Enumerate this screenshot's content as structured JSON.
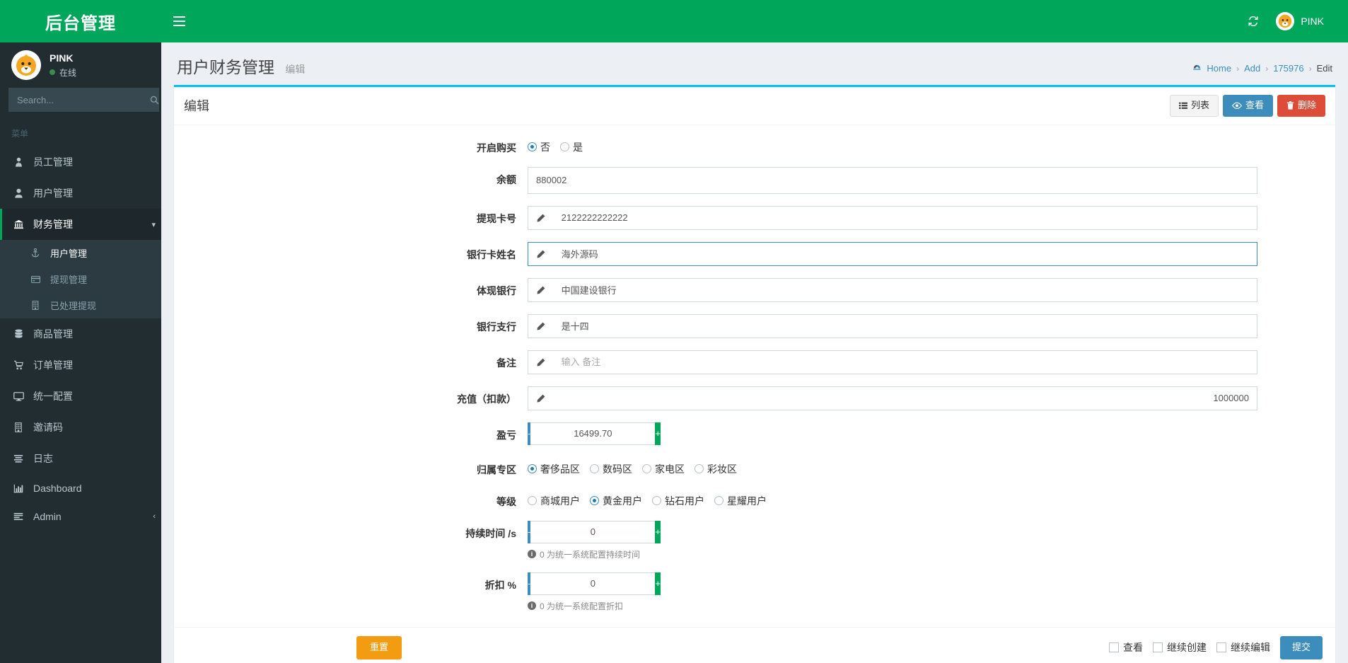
{
  "brand": {
    "logo_text": "后台管理"
  },
  "topbar": {
    "menu_toggle_icon": "hamburger-icon",
    "refresh_icon": "refresh-icon",
    "user_name": "PINK"
  },
  "sidebar": {
    "user": {
      "name": "PINK",
      "status": "在线"
    },
    "search": {
      "placeholder": "Search...",
      "value": "",
      "icon": "search-icon"
    },
    "menu_header": "菜单",
    "items": [
      {
        "label": "员工管理",
        "icon": "user-tie-icon",
        "active": false
      },
      {
        "label": "用户管理",
        "icon": "user-icon",
        "active": false
      },
      {
        "label": "财务管理",
        "icon": "bank-icon",
        "active": true,
        "chevron": "▾",
        "children": [
          {
            "label": "用户管理",
            "icon": "anchor-icon",
            "active": true
          },
          {
            "label": "提现管理",
            "icon": "credit-card-icon",
            "active": false
          },
          {
            "label": "已处理提现",
            "icon": "building-icon",
            "active": false
          }
        ]
      },
      {
        "label": "商品管理",
        "icon": "database-icon",
        "active": false
      },
      {
        "label": "订单管理",
        "icon": "cart-icon",
        "active": false
      },
      {
        "label": "统一配置",
        "icon": "desktop-icon",
        "active": false
      },
      {
        "label": "邀请码",
        "icon": "building-icon",
        "active": false
      },
      {
        "label": "日志",
        "icon": "list-icon",
        "active": false
      },
      {
        "label": "Dashboard",
        "icon": "chart-bar-icon",
        "active": false
      },
      {
        "label": "Admin",
        "icon": "list-alt-icon",
        "active": false,
        "chevron": "‹"
      }
    ]
  },
  "header": {
    "title": "用户财务管理",
    "subtitle": "编辑",
    "breadcrumb": [
      {
        "label": "Home",
        "icon": "dashboard-icon"
      },
      {
        "label": "Add"
      },
      {
        "label": "175976"
      },
      {
        "label": "Edit"
      }
    ],
    "separator": "›"
  },
  "box": {
    "title": "编辑",
    "tools": [
      {
        "label": "列表",
        "icon": "list-icon",
        "style": "default"
      },
      {
        "label": "查看",
        "icon": "eye-icon",
        "style": "info"
      },
      {
        "label": "删除",
        "icon": "trash-icon",
        "style": "danger"
      }
    ]
  },
  "form": {
    "purchase": {
      "label": "开启购买",
      "options": [
        {
          "label": "否",
          "selected": true
        },
        {
          "label": "是",
          "selected": false
        }
      ]
    },
    "balance": {
      "label": "余额",
      "value": "880002",
      "placeholder": ""
    },
    "card_no": {
      "label": "提现卡号",
      "value": "2122222222222",
      "placeholder": "",
      "icon": "pencil-icon"
    },
    "card_name": {
      "label": "银行卡姓名",
      "value": "海外源码",
      "placeholder": "",
      "icon": "pencil-icon",
      "focused": true
    },
    "bank": {
      "label": "体现银行",
      "value": "中国建设银行",
      "placeholder": "",
      "icon": "pencil-icon"
    },
    "branch": {
      "label": "银行支行",
      "value": "是十四",
      "placeholder": "",
      "icon": "pencil-icon"
    },
    "remark": {
      "label": "备注",
      "value": "",
      "placeholder": "输入 备注",
      "icon": "pencil-icon"
    },
    "recharge": {
      "label": "充值（扣款）",
      "value": "1000000",
      "placeholder": "",
      "icon": "pencil-icon"
    },
    "profit": {
      "label": "盈亏",
      "value": "16499.70",
      "minus": "-",
      "plus": "+"
    },
    "zone": {
      "label": "归属专区",
      "options": [
        {
          "label": "奢侈品区",
          "selected": true
        },
        {
          "label": "数码区",
          "selected": false
        },
        {
          "label": "家电区",
          "selected": false
        },
        {
          "label": "彩妆区",
          "selected": false
        }
      ]
    },
    "level": {
      "label": "等级",
      "options": [
        {
          "label": "商城用户",
          "selected": false
        },
        {
          "label": "黄金用户",
          "selected": true
        },
        {
          "label": "钻石用户",
          "selected": false
        },
        {
          "label": "星耀用户",
          "selected": false
        }
      ]
    },
    "duration": {
      "label": "持续时间 /s",
      "value": "0",
      "minus": "-",
      "plus": "+",
      "hint": "0 为统一系统配置持续时间"
    },
    "discount": {
      "label": "折扣 %",
      "value": "0",
      "minus": "-",
      "plus": "+",
      "hint": "0 为统一系统配置折扣"
    }
  },
  "footer": {
    "reset_label": "重置",
    "checkboxes": [
      {
        "label": "查看",
        "checked": false
      },
      {
        "label": "继续创建",
        "checked": false
      },
      {
        "label": "继续编辑",
        "checked": false
      }
    ],
    "submit_label": "提交"
  },
  "colors": {
    "brand_green": "#00a65a",
    "sidebar_dark": "#222d32",
    "accent_blue": "#3c8dbc",
    "box_top": "#00c0ef",
    "danger": "#dd4b39",
    "warning": "#f39c12"
  }
}
